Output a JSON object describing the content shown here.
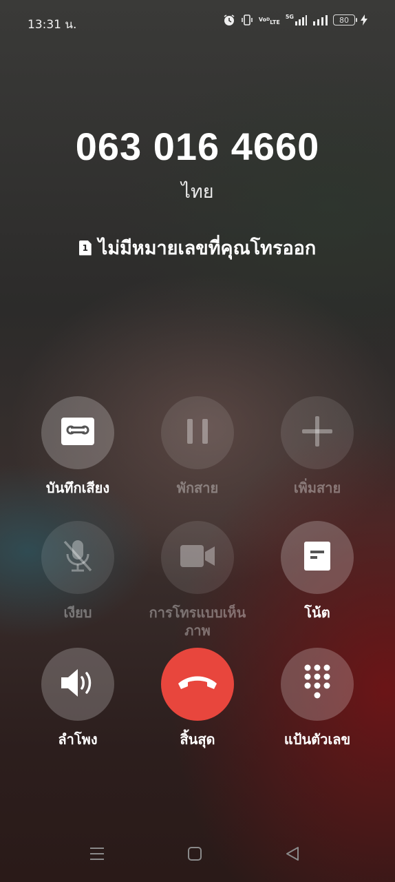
{
  "status_bar": {
    "time": "13:31 น.",
    "volte": "VoLTE",
    "net": "5G",
    "battery": "80"
  },
  "call": {
    "number": "063 016 4660",
    "region": "ไทย",
    "sim_slot": "1",
    "status": "ไม่มีหมายเลขที่คุณโทรออก"
  },
  "buttons": {
    "record": "บันทึกเสียง",
    "hold": "พักสาย",
    "add_call": "เพิ่มสาย",
    "mute": "เงียบ",
    "video_call": "การโทรแบบเห็นภาพ",
    "notes": "โน้ต",
    "speaker": "ลำโพง",
    "end_call": "สิ้นสุด",
    "keypad": "แป้นตัวเลข"
  },
  "colors": {
    "end_call": "#e8463d"
  }
}
